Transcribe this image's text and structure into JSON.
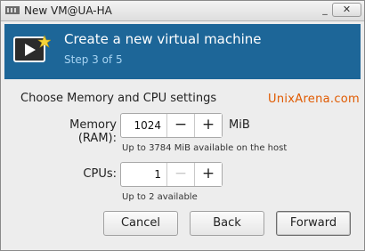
{
  "window": {
    "title": "New VM@UA-HA",
    "minimize_glyph": "_",
    "close_glyph": "✕"
  },
  "banner": {
    "title": "Create a new virtual machine",
    "step": "Step 3 of 5",
    "icon": "vm-monitor-icon",
    "color": "#1d6698"
  },
  "section_title": "Choose Memory and CPU settings",
  "watermark": "UnixArena.com",
  "memory": {
    "label": "Memory (RAM):",
    "value": "1024",
    "unit": "MiB",
    "hint": "Up to 3784 MiB available on the host",
    "decrement": "−",
    "increment": "+"
  },
  "cpus": {
    "label": "CPUs:",
    "value": "1",
    "hint": "Up to 2 available",
    "decrement": "−",
    "increment": "+"
  },
  "buttons": {
    "cancel": "Cancel",
    "back": "Back",
    "forward": "Forward"
  }
}
